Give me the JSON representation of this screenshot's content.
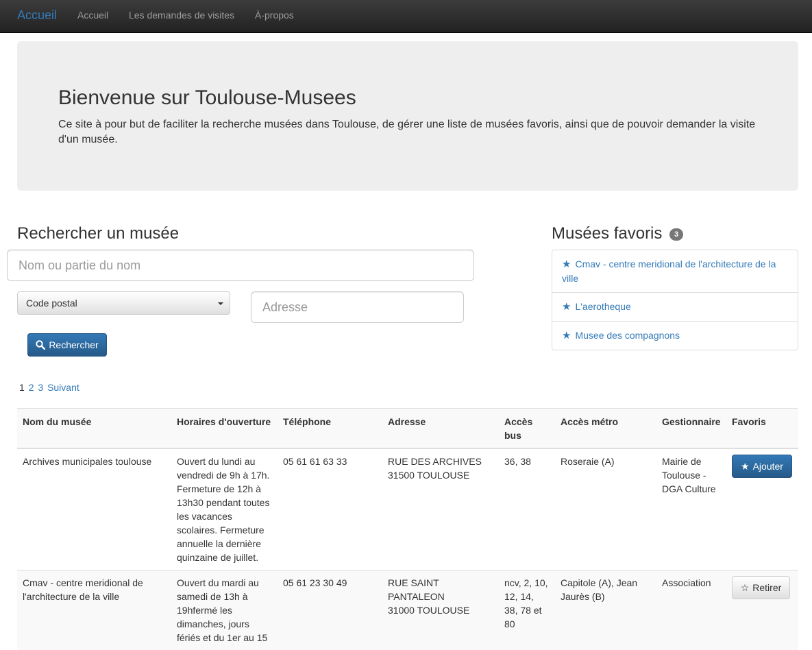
{
  "navbar": {
    "brand": "Accueil",
    "links": [
      "Accueil",
      "Les demandes de visites",
      "À-propos"
    ]
  },
  "jumbotron": {
    "title": "Bienvenue sur Toulouse-Musees",
    "text": "Ce site à pour but de faciliter la recherche musées dans Toulouse, de gérer une liste de musées favoris, ainsi que de pouvoir demander la visite d'un musée."
  },
  "search": {
    "title": "Rechercher un musée",
    "name_placeholder": "Nom ou partie du nom",
    "postal_select": "Code postal",
    "address_placeholder": "Adresse",
    "button_label": "Rechercher",
    "button_icon": "search-icon"
  },
  "favorites": {
    "title": "Musées favoris",
    "count": "3",
    "items": [
      "Cmav - centre meridional de l'architecture de la ville",
      "L'aerotheque",
      "Musee des compagnons"
    ]
  },
  "pagination": {
    "current": "1",
    "pages": [
      "2",
      "3"
    ],
    "next": "Suivant"
  },
  "table": {
    "headers": [
      "Nom du musée",
      "Horaires d'ouverture",
      "Téléphone",
      "Adresse",
      "Accès bus",
      "Accès métro",
      "Gestionnaire",
      "Favoris"
    ],
    "rows": [
      {
        "name": "Archives municipales toulouse",
        "hours": "Ouvert du lundi au vendredi de 9h à 17h. Fermeture de 12h à 13h30 pendant toutes les vacances scolaires. Fermeture annuelle la dernière quinzaine de juillet.",
        "phone": "05 61 61 63 33",
        "address_line1": "RUE DES ARCHIVES",
        "address_line2": "31500 TOULOUSE",
        "bus": "36, 38",
        "metro": "Roseraie (A)",
        "manager": "Mairie de Toulouse - DGA Culture",
        "fav_label": "Ajouter"
      },
      {
        "name": "Cmav - centre meridional de l'architecture de la ville",
        "hours": "Ouvert du mardi au samedi de 13h à 19hfermé les dimanches, jours fériés et du 1er au 15",
        "phone": "05 61 23 30 49",
        "address_line1": "RUE SAINT PANTALEON",
        "address_line2": "31000 TOULOUSE",
        "bus": "ncv, 2, 10, 12, 14, 38, 78 et 80",
        "metro": "Capitole (A), Jean Jaurès (B)",
        "manager": "Association",
        "fav_label": "Retirer"
      }
    ]
  },
  "colors": {
    "primary": "#337ab7",
    "navbar_bg": "#222222",
    "jumbotron_bg": "#eeeeee"
  }
}
